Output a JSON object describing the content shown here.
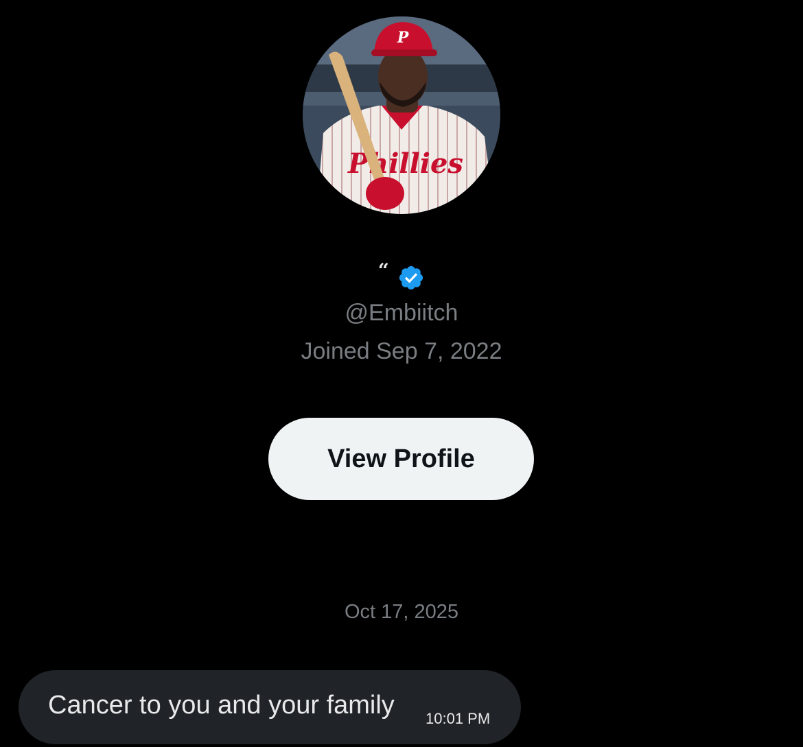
{
  "profile": {
    "display_name": "“",
    "handle": "@Embiitch",
    "joined": "Joined Sep 7, 2022",
    "verified": true,
    "avatar_icon": "avatar-photo",
    "view_profile_label": "View Profile"
  },
  "conversation": {
    "date_separator": "Oct 17, 2025",
    "messages": [
      {
        "text": "Cancer to you and your family",
        "time": "10:01 PM"
      }
    ]
  },
  "colors": {
    "background": "#000000",
    "verified_badge": "#1d9bf0",
    "secondary_text": "#7a7e83",
    "button_bg": "#eff3f4",
    "bubble_bg": "#202327"
  }
}
